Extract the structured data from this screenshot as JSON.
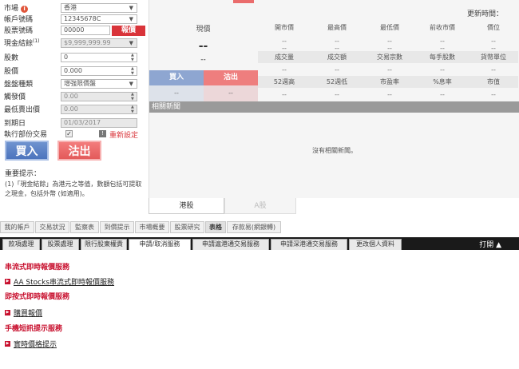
{
  "form": {
    "market_label": "市場",
    "market_value": "香港",
    "account_label": "帳戶號碼",
    "account_value": "12345678C",
    "stock_label": "股票號碼",
    "stock_value": "00000",
    "quote_button": "報價",
    "cash_label": "現金結餘",
    "cash_sup": "(1)",
    "cash_value": "$9,999,999.99",
    "qty_label": "股數",
    "qty_value": "0",
    "price_label": "股價",
    "price_value": "0.000",
    "order_type_label": "盤盤種類",
    "order_type_value": "增強限價盤",
    "trigger_label": "觸發價",
    "trigger_value": "0.00",
    "min_sell_label": "最低賣出價",
    "min_sell_value": "0.00",
    "expiry_label": "到期日",
    "expiry_value": "01/03/2017",
    "partial_label": "執行部份交易",
    "partial_checked": "✓",
    "reset_label": "重新設定",
    "buy_button": "買入",
    "sell_button": "沽出",
    "notice_title": "重要提示：",
    "notice_body": "(1)「現金結餘」為港元之等值，數額包括可提取之現金，包括外幣 (如適用)。"
  },
  "quote": {
    "update_time_label": "更新時間：",
    "current_label": "現價",
    "current_value": "--",
    "current_change": "--",
    "headers_row1": [
      "開市價",
      "最高價",
      "最低價",
      "前收市價",
      "價位"
    ],
    "values_row1": [
      "--",
      "--",
      "--",
      "--",
      "--"
    ],
    "extra_row1": [
      "--",
      "--",
      "--",
      "--",
      "--"
    ],
    "headers_row2": [
      "成交量",
      "成交額",
      "交易宗數",
      "每手股數",
      "貨幣單位"
    ],
    "values_row2": [
      "--",
      "--",
      "--",
      "--",
      "--"
    ],
    "headers_row3": [
      "52週高",
      "52週低",
      "市盈率",
      "%息率",
      "市值"
    ],
    "values_row3": [
      "--",
      "--",
      "--",
      "--",
      "--"
    ],
    "buy_label": "買入",
    "sell_label": "沽出",
    "buy_value": "--",
    "sell_value": "--",
    "news_title": "相關新聞",
    "news_empty": "沒有相關新聞。",
    "market_tab_active": "港股",
    "market_tab_inactive": "A股"
  },
  "tabs1": [
    "我的帳戶",
    "交易狀況",
    "監察表",
    "到價提示",
    "市場概要",
    "股票研究",
    "表格",
    "存款易(網銀轉)"
  ],
  "tabs2": [
    "款項處理",
    "股票處理",
    "限行股東權責",
    "申請/取消服務",
    "申請滬港通交易服務",
    "申請深港通交易服務",
    "更改個人資料"
  ],
  "print_label": "打開 ▲",
  "services": {
    "streaming_head": "串流式即時報價服務",
    "streaming_link": "AA Stocks串流式即時報價服務",
    "snapshot_head": "即按式即時報價服務",
    "snapshot_link": "購買報價",
    "sms_head": "手機短訊提示服務",
    "sms_link": "實時價格提示"
  },
  "colors": {
    "accent_red": "#d9343a",
    "buy_blue": "#5b80c4",
    "sell_red": "#ea6c6c"
  }
}
